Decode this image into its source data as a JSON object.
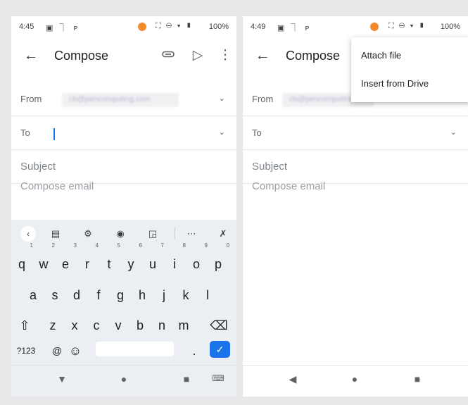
{
  "left": {
    "status_bar": {
      "time": "4:45",
      "icons": "▣ ⏋ ᴘ",
      "system": "⛶ ⊖ ▾ ▮",
      "battery": "100%"
    },
    "app_bar": {
      "title": "Compose",
      "back_icon": "←",
      "attach_icon": "⌀",
      "send_icon": "▷",
      "more_icon": "⋮"
    },
    "from": {
      "label": "From",
      "value": "cb@pencomputing.com",
      "chevron": "⌄"
    },
    "to": {
      "label": "To",
      "chevron": "⌄"
    },
    "subject": {
      "placeholder": "Subject"
    },
    "body": {
      "placeholder": "Compose email"
    },
    "keyboard": {
      "toolbar": [
        "‹",
        "▤",
        "⚙",
        "◉",
        "◲",
        "⋯",
        "✗"
      ],
      "row1": [
        {
          "k": "q",
          "n": "1"
        },
        {
          "k": "w",
          "n": "2"
        },
        {
          "k": "e",
          "n": "3"
        },
        {
          "k": "r",
          "n": "4"
        },
        {
          "k": "t",
          "n": "5"
        },
        {
          "k": "y",
          "n": "6"
        },
        {
          "k": "u",
          "n": "7"
        },
        {
          "k": "i",
          "n": "8"
        },
        {
          "k": "o",
          "n": "9"
        },
        {
          "k": "p",
          "n": "0"
        }
      ],
      "row2": [
        "a",
        "s",
        "d",
        "f",
        "g",
        "h",
        "j",
        "k",
        "l"
      ],
      "row3": [
        "⇧",
        "z",
        "x",
        "c",
        "v",
        "b",
        "n",
        "m",
        "⌫"
      ],
      "row4": {
        "symbols": "?123",
        "at": "@",
        "emoji": "☺",
        "period": ".",
        "enter": "✓"
      }
    },
    "nav": {
      "back": "▼",
      "home": "●",
      "recents": "■",
      "keyboard": "⌨"
    }
  },
  "right": {
    "status_bar": {
      "time": "4:49",
      "icons": "▣ ⏋ ᴘ",
      "system": "⛶ ⊖ ▾ ▮",
      "battery": "100%"
    },
    "app_bar": {
      "title": "Compose",
      "back_icon": "←"
    },
    "from": {
      "label": "From",
      "value": "cb@pencomputing.com"
    },
    "to": {
      "label": "To",
      "chevron": "⌄"
    },
    "subject": {
      "placeholder": "Subject"
    },
    "body": {
      "placeholder": "Compose email"
    },
    "menu": {
      "attach_file": "Attach file",
      "insert_from_drive": "Insert from Drive"
    },
    "nav": {
      "back": "◀",
      "home": "●",
      "recents": "■"
    }
  },
  "colors": {
    "accent": "#1a73e8",
    "recording_dot": "#f28b2c",
    "background": "#e8e8ea",
    "keyboard": "#ebeef3"
  }
}
